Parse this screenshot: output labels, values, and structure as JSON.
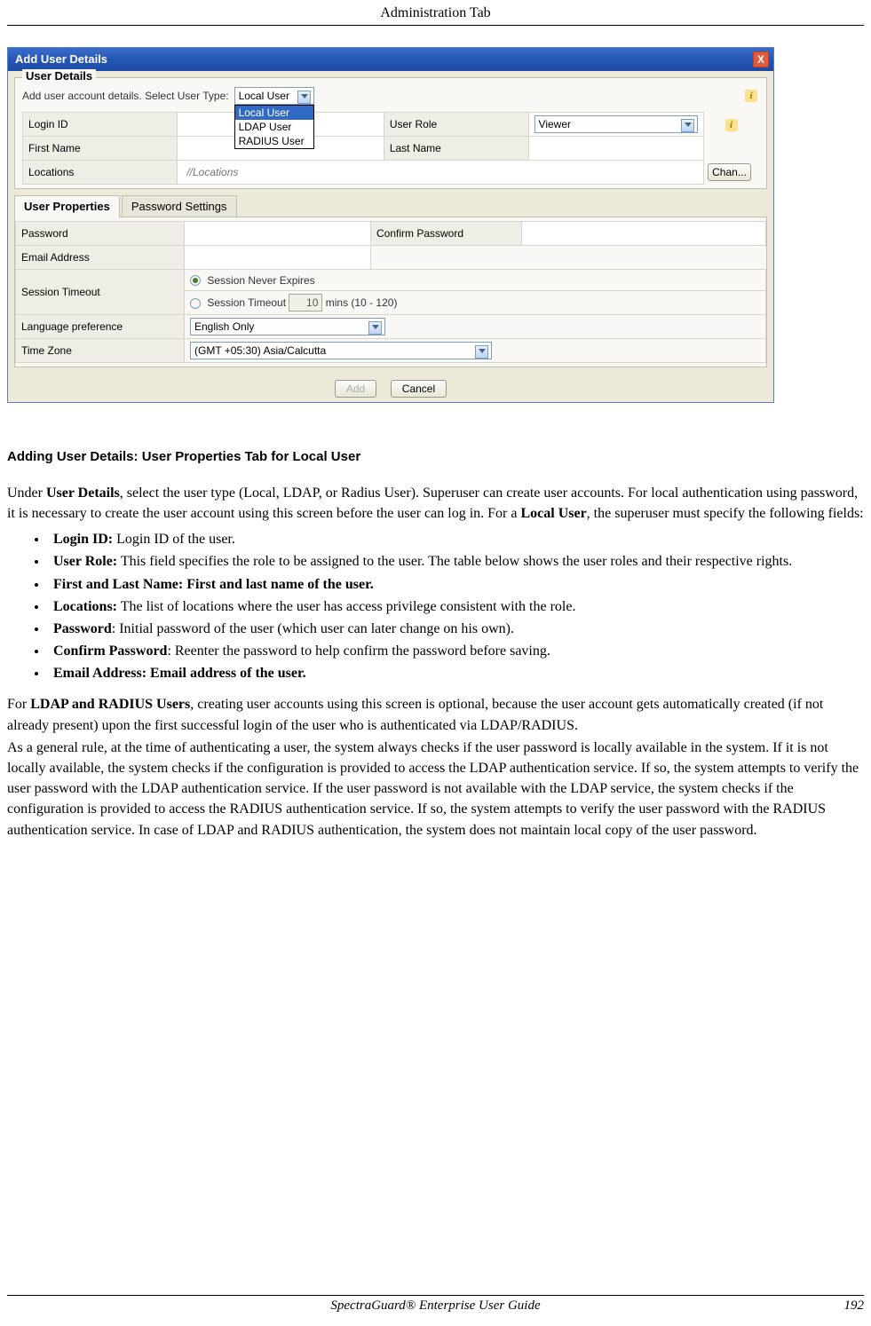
{
  "header": {
    "title": "Administration Tab"
  },
  "dialog": {
    "title": "Add User Details",
    "close": "X",
    "group_user_details": "User Details",
    "instruction": "Add user account details.  Select User Type:",
    "user_type_selected": "Local User",
    "user_type_options": [
      "Local User",
      "LDAP User",
      "RADIUS User"
    ],
    "fields": {
      "login_id": "Login ID",
      "user_role": "User Role",
      "user_role_value": "Viewer",
      "first_name": "First Name",
      "last_name": "Last Name",
      "locations": "Locations",
      "locations_placeholder": "//Locations",
      "change_btn": "Chan..."
    },
    "tabs": {
      "props": "User Properties",
      "pwd": "Password Settings"
    },
    "props": {
      "password": "Password",
      "confirm": "Confirm Password",
      "email": "Email Address",
      "session_timeout": "Session Timeout",
      "never_expires": "Session Never Expires",
      "timeout_label": "Session Timeout",
      "timeout_value": "10",
      "timeout_range": "mins (10 - 120)",
      "lang_pref": "Language preference",
      "lang_value": "English Only",
      "tz": "Time Zone",
      "tz_value": "(GMT +05:30)   Asia/Calcutta"
    },
    "buttons": {
      "add": "Add",
      "cancel": "Cancel"
    }
  },
  "doc": {
    "heading": "Adding User Details: User Properties Tab for Local User",
    "p1_a": "Under ",
    "p1_b": "User Details",
    "p1_c": ", select the user type (Local, LDAP, or Radius User). Superuser can create user accounts. For local authentication using password, it is necessary to create the user account using this screen before the user can log in. For a ",
    "p1_d": "Local User",
    "p1_e": ", the superuser must specify the following fields:",
    "bullets": [
      {
        "b": "Login ID:",
        "t": " Login ID of the user."
      },
      {
        "b": "User Role:",
        "t": " This field specifies the role to be assigned to the user. The table below shows the user roles and their respective rights."
      },
      {
        "b": "First and Last Name: First and last name of the user.",
        "t": ""
      },
      {
        "b": "Locations:",
        "t": " The list of locations where the user has access privilege consistent with the role."
      },
      {
        "b": "Password",
        "t": ": Initial password of the user (which user can later change on his own)."
      },
      {
        "b": "Confirm Password",
        "t": ": Reenter the password to help confirm the password before saving."
      },
      {
        "b": "Email Address: Email address of the user.",
        "t": ""
      }
    ],
    "p2_a": "For  ",
    "p2_b": "LDAP and RADIUS Users",
    "p2_c": ", creating user accounts using this screen is optional, because the user account gets automatically created (if not already present) upon the first successful login of the user who is authenticated via LDAP/RADIUS.",
    "p3": "As a general rule, at the time of authenticating a user, the system always checks if the user password is locally available in the system. If it is not locally available, the system checks if the configuration is provided to access the LDAP authentication service. If so, the system attempts to verify the user password with the LDAP authentication service. If the user password is not available with the LDAP service, the system checks if the configuration is provided to access the RADIUS authentication service. If so, the system attempts to verify the user password with the RADIUS authentication service. In case of LDAP and RADIUS authentication, the system does not maintain local copy of the user password."
  },
  "footer": {
    "center": "SpectraGuard® Enterprise User Guide",
    "page": "192"
  }
}
